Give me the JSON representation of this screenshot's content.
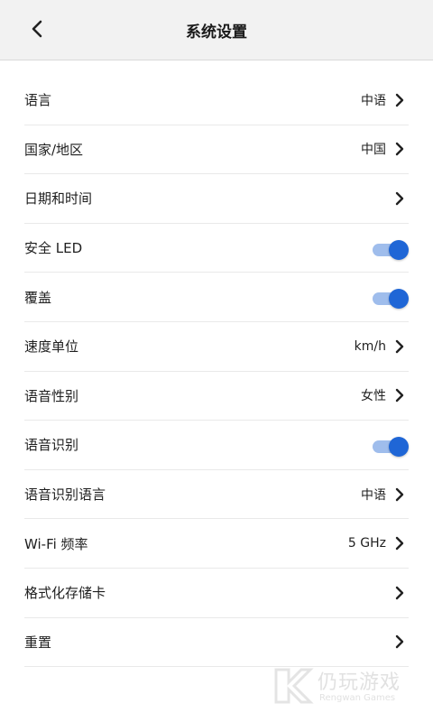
{
  "header": {
    "title": "系统设置",
    "back_icon": "chevron-left-icon"
  },
  "settings": [
    {
      "label": "语言",
      "type": "link",
      "value": "中语"
    },
    {
      "label": "国家/地区",
      "type": "link",
      "value": "中国"
    },
    {
      "label": "日期和时间",
      "type": "link",
      "value": ""
    },
    {
      "label": "安全 LED",
      "type": "toggle",
      "on": true
    },
    {
      "label": "覆盖",
      "type": "toggle",
      "on": true
    },
    {
      "label": "速度单位",
      "type": "link",
      "value": "km/h"
    },
    {
      "label": "语音性别",
      "type": "link",
      "value": "女性"
    },
    {
      "label": "语音识别",
      "type": "toggle",
      "on": true
    },
    {
      "label": "语音识别语言",
      "type": "link",
      "value": "中语"
    },
    {
      "label": "Wi-Fi 频率",
      "type": "link",
      "value": "5 GHz"
    },
    {
      "label": "格式化存储卡",
      "type": "link",
      "value": ""
    },
    {
      "label": "重置",
      "type": "link",
      "value": ""
    }
  ],
  "watermark": {
    "text": "仍玩游戏",
    "subtext": "Rengwan Games"
  },
  "colors": {
    "accent": "#1f66d6",
    "toggle_track": "#9fbdec",
    "header_bg": "#f2f2f2",
    "divider": "#e9e9e9"
  }
}
